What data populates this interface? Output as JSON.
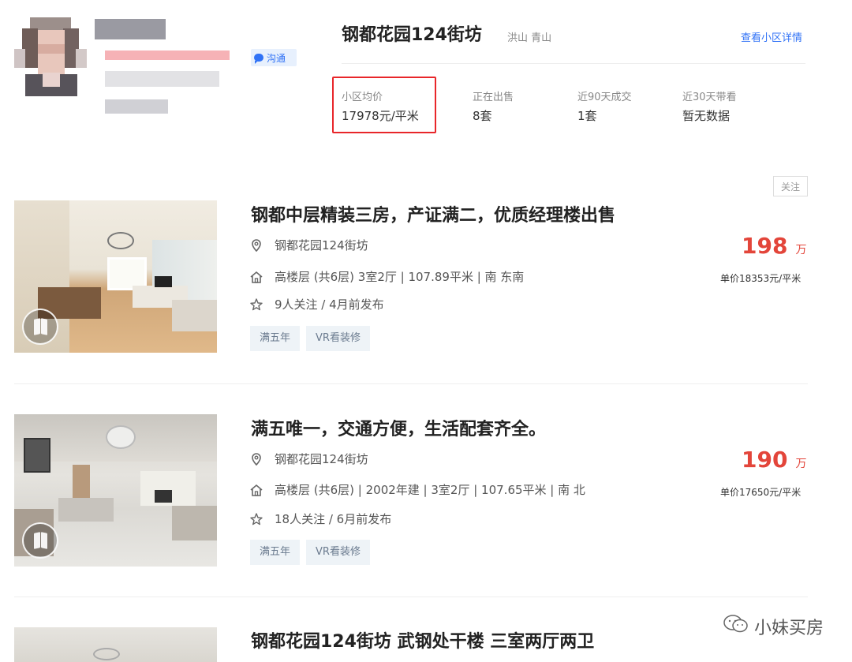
{
  "community": {
    "title": "钢都花园124街坊",
    "location": "洪山 青山",
    "detail_link": "查看小区详情",
    "stats": [
      {
        "label": "小区均价",
        "value": "17978元/平米"
      },
      {
        "label": "正在出售",
        "value": "8套"
      },
      {
        "label": "近90天成交",
        "value": "1套"
      },
      {
        "label": "近30天带看",
        "value": "暂无数据"
      }
    ]
  },
  "agent": {
    "chat_label": "沟通"
  },
  "follow_label": "关注",
  "listings": [
    {
      "title": "钢都中层精装三房，产证满二，优质经理楼出售",
      "community": "钢都花园124街坊",
      "house_info": "高楼层 (共6层) 3室2厅 | 107.89平米 | 南 东南",
      "follow_info": "9人关注 / 4月前发布",
      "tags": [
        "满五年",
        "VR看装修"
      ],
      "price": "198",
      "price_unit": "万",
      "unit_price": "单价18353元/平米"
    },
    {
      "title": "满五唯一，交通方便，生活配套齐全。",
      "community": "钢都花园124街坊",
      "house_info": "高楼层 (共6层) | 2002年建 | 3室2厅 | 107.65平米 | 南 北",
      "follow_info": "18人关注 / 6月前发布",
      "tags": [
        "满五年",
        "VR看装修"
      ],
      "price": "190",
      "price_unit": "万",
      "unit_price": "单价17650元/平米"
    },
    {
      "title": "钢都花园124街坊 武钢处干楼 三室两厅两卫"
    }
  ],
  "watermark": "小妹买房",
  "colors": {
    "accent_blue": "#3072f6",
    "price_red": "#e3453a",
    "highlight_red": "#e8262a",
    "tag_bg": "#eef3f7"
  }
}
